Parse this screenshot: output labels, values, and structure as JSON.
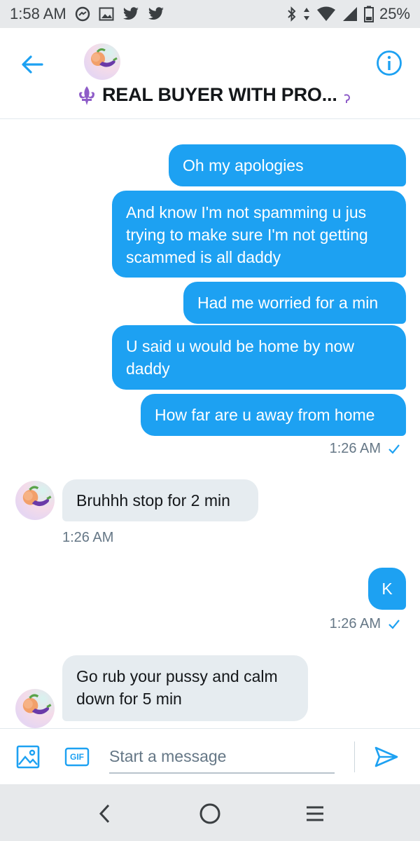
{
  "status_bar": {
    "time": "1:58 AM",
    "battery": "25%",
    "icons": [
      "messenger-icon",
      "gallery-icon",
      "twitter-icon",
      "twitter-icon",
      "bluetooth-icon",
      "data-arrows-icon",
      "wifi-icon",
      "signal-icon",
      "battery-icon"
    ]
  },
  "header": {
    "title": "REAL BUYER WITH PRO...",
    "back_icon": "back-arrow-icon",
    "info_icon": "info-icon",
    "accent": "#1da1f2"
  },
  "messages": [
    {
      "dir": "out",
      "text": "Oh my apologies"
    },
    {
      "dir": "out",
      "text": "And know I'm not spamming u jus trying to make sure I'm not getting scammed is all daddy"
    },
    {
      "dir": "out",
      "text": "Had me worried for a min"
    },
    {
      "dir": "out",
      "text": "U said u would be home by now daddy"
    },
    {
      "dir": "out",
      "text": "How far are u away from home"
    },
    {
      "dir": "in",
      "text": "Bruhhh stop for 2 min"
    },
    {
      "dir": "out",
      "text": "K"
    },
    {
      "dir": "in",
      "text": "Go rub your pussy and calm down for 5 min"
    }
  ],
  "timestamps": [
    "1:26 AM",
    "1:26 AM",
    "1:26 AM"
  ],
  "composer": {
    "placeholder": "Start a message",
    "gif_label": "GIF",
    "icons": [
      "image-icon",
      "gif-icon",
      "send-icon"
    ]
  },
  "nav_bar": {
    "icons": [
      "nav-back-icon",
      "nav-home-icon",
      "nav-menu-icon"
    ]
  },
  "colors": {
    "outgoing_bubble": "#1da1f2",
    "incoming_bubble": "#e6ecf0",
    "timestamp": "#657786"
  }
}
